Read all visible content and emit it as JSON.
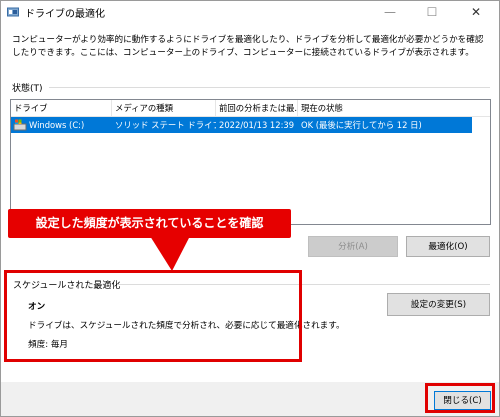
{
  "window": {
    "title": "ドライブの最適化",
    "minimize_glyph": "—",
    "maximize_glyph": "☐",
    "close_glyph": "✕"
  },
  "description": "コンピューターがより効率的に動作するようにドライブを最適化したり、ドライブを分析して最適化が必要かどうかを確認したりできます。ここには、コンピューター上のドライブ、コンピューターに接続されているドライブが表示されます。",
  "status": {
    "label": "状態(T)",
    "columns": [
      "ドライブ",
      "メディアの種類",
      "前回の分析または最...",
      "現在の状態"
    ],
    "rows": [
      {
        "drive": "Windows (C:)",
        "media": "ソリッド ステート ドライブ",
        "last": "2022/01/13 12:39",
        "state": "OK (最後に実行してから 12 日)"
      }
    ]
  },
  "buttons": {
    "analyze": "分析(A)",
    "optimize": "最適化(O)",
    "settings": "設定の変更(S)",
    "close": "閉じる(C)"
  },
  "schedule": {
    "title": "スケジュールされた最適化",
    "status": "オン",
    "description": "ドライブは、スケジュールされた頻度で分析され、必要に応じて最適化されます。",
    "frequency": "頻度: 毎月"
  },
  "annotation": {
    "callout": "設定した頻度が表示されていることを確認"
  },
  "colors": {
    "selection": "#0078d7",
    "highlight": "#e00000"
  },
  "icons": {
    "app": "defrag-icon",
    "drive": "drive-icon"
  }
}
